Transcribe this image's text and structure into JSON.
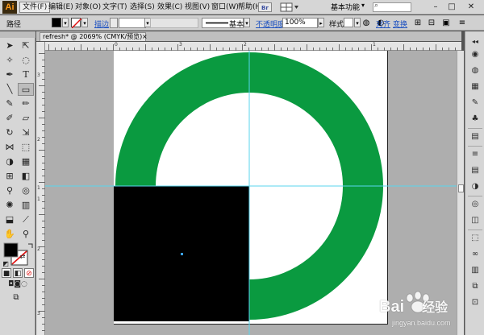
{
  "app": {
    "logo": "Ai"
  },
  "menu": {
    "items": [
      "文件(F)",
      "编辑(E)",
      "对象(O)",
      "文字(T)",
      "选择(S)",
      "效果(C)",
      "视图(V)",
      "窗口(W)",
      "帮助(H)"
    ],
    "active_index": 0,
    "bridge_label": "Br",
    "workspace": "基本功能",
    "window_buttons": [
      "–",
      "□",
      "✕"
    ]
  },
  "control_bar": {
    "selection_label": "路径",
    "stroke_label": "描边",
    "brush_label": "基本",
    "opacity_label": "不透明度",
    "opacity_value": "100%",
    "style_label": "样式",
    "align_label": "对齐",
    "transform_label": "变换"
  },
  "document": {
    "tab_title": "refresh* @ 2069% (CMYK/预览)",
    "close_glyph": "×"
  },
  "rulers": {
    "top_numbers": [
      "0",
      "3",
      "2",
      "1"
    ],
    "left_numbers": [
      "3",
      "2",
      "1",
      "1",
      "2",
      "3"
    ]
  },
  "artwork": {
    "ring_color": "#0a9a40",
    "square_color": "#000000",
    "guide_color": "#58d6ee",
    "artboard_color": "#ffffff",
    "pasteboard_color": "#aeaeae"
  },
  "watermark": {
    "brand": "Bai",
    "brand_suffix": "经验",
    "url": "jingyan.baidu.com"
  },
  "icons": {
    "tools": [
      "selection-arrow",
      "direct-selection",
      "magic-wand",
      "lasso",
      "pen",
      "type",
      "line-segment",
      "rectangle",
      "paintbrush",
      "pencil",
      "blob-brush",
      "eraser",
      "rotate",
      "scale",
      "width",
      "free-transform",
      "shape-builder",
      "perspective-grid",
      "mesh",
      "gradient",
      "eyedropper",
      "blend",
      "symbol-sprayer",
      "column-graph",
      "artboard",
      "slice",
      "hand",
      "zoom"
    ],
    "right_panel": [
      "color-guide",
      "color",
      "swatches",
      "brushes",
      "symbols",
      "graphic-styles",
      "stroke",
      "gradient",
      "transparency",
      "appearance",
      "layers",
      "artboards",
      "links",
      "align"
    ]
  }
}
